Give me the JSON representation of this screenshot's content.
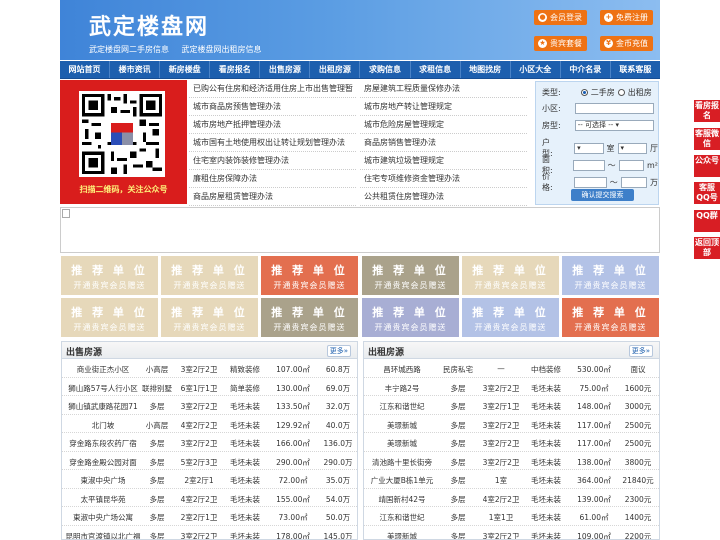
{
  "header": {
    "title": "武定楼盘网",
    "subtitles": [
      "武定楼盘网二手房信息",
      "武定楼盘网出租房信息"
    ],
    "buttons": [
      "会员登录",
      "免费注册",
      "贵宾套餐",
      "金币充值"
    ]
  },
  "nav": [
    "网站首页",
    "楼市资讯",
    "新房楼盘",
    "看房报名",
    "出售房源",
    "出租房源",
    "求购信息",
    "求租信息",
    "地图找房",
    "小区大全",
    "中介名录",
    "联系客服"
  ],
  "qr": {
    "caption": "扫描二维码，关注公众号"
  },
  "links_left": [
    "已购公有住房和经济适用住房上市出售管理暂",
    "城市商品房预售管理办法",
    "城市房地产抵押管理办法",
    "城市国有土地使用权出让转让规划管理办法",
    "住宅室内装饰装修管理办法",
    "廉租住房保障办法",
    "商品房屋租赁管理办法"
  ],
  "links_right": [
    "房屋建筑工程质量保修办法",
    "城市房地产转让管理规定",
    "城市危险房屋管理规定",
    "商品房销售管理办法",
    "城市建筑垃圾管理规定",
    "住宅专项维修资金管理办法",
    "公共租赁住房管理办法"
  ],
  "search": {
    "type_label": "类型:",
    "type_options": [
      "二手房",
      "出租房"
    ],
    "community_label": "小区:",
    "layout_label": "房型:",
    "layout_value": "-- 可选择 --",
    "rooms_label": "户型:",
    "room_unit": "室",
    "hall_unit": "厅",
    "area_label": "面积:",
    "area_sep": "～",
    "area_unit": "m²",
    "price_label": "价格:",
    "price_sep": "～",
    "price_unit": "万",
    "submit": "确认提交搜索"
  },
  "ads": {
    "title": "推 荐 单 位",
    "subtitle": "开通贵宾会员赠送",
    "colors": [
      "#e6d8ba",
      "#e6d8ba",
      "#e36f4f",
      "#aaa28b",
      "#e6d8ba",
      "#b3c2e6",
      "#e6d8ba",
      "#e6d8ba",
      "#aaa28b",
      "#a8aed4",
      "#b3c2e6",
      "#e36f4f"
    ]
  },
  "sale": {
    "title": "出售房源",
    "more": "更多",
    "rows": [
      [
        "商业街正杰小区",
        "小高层",
        "3室2厅2卫",
        "精致装修",
        "107.00㎡",
        "60.8万"
      ],
      [
        "狮山路57号人行小区",
        "联排别墅",
        "6室1厅1卫",
        "简单装修",
        "130.00㎡",
        "69.0万"
      ],
      [
        "狮山镇武康路花园71",
        "多层",
        "3室2厅2卫",
        "毛坯未装",
        "133.50㎡",
        "32.0万"
      ],
      [
        "北门坡",
        "小高层",
        "4室2厅2卫",
        "毛坯未装",
        "129.92㎡",
        "40.0万"
      ],
      [
        "穿金路东段农药厂宿",
        "多层",
        "3室2厅2卫",
        "毛坯未装",
        "166.00㎡",
        "136.0万"
      ],
      [
        "穿金路金殿公园对面",
        "多层",
        "5室2厅3卫",
        "毛坯未装",
        "290.00㎡",
        "290.0万"
      ],
      [
        "東淑中央广场",
        "多层",
        "2室2厅1",
        "毛坯未装",
        "72.00㎡",
        "35.0万"
      ],
      [
        "太平镇昆华苑",
        "多层",
        "4室2厅2卫",
        "毛坯未装",
        "155.00㎡",
        "54.0万"
      ],
      [
        "東淑中央广场公寓",
        "多层",
        "2室2厅1卫",
        "毛坯未装",
        "73.00㎡",
        "50.0万"
      ],
      [
        "昆明市官渡镇以北广福",
        "多层",
        "3室2厅2卫",
        "毛坯未装",
        "178.00㎡",
        "145.0万"
      ]
    ]
  },
  "rent": {
    "title": "出租房源",
    "more": "更多",
    "rows": [
      [
        "昌环城西路",
        "民房私宅",
        "—",
        "中档装修",
        "530.00㎡",
        "面议"
      ],
      [
        "丰宁路2号",
        "多层",
        "3室2厅2卫",
        "毛坯未装",
        "75.00㎡",
        "1600元"
      ],
      [
        "江东和谐世纪",
        "多层",
        "3室2厅1卫",
        "毛坯未装",
        "148.00㎡",
        "3000元"
      ],
      [
        "美璟新城",
        "多层",
        "3室2厅2卫",
        "毛坯未装",
        "117.00㎡",
        "2500元"
      ],
      [
        "美璟新城",
        "多层",
        "3室2厅2卫",
        "毛坯未装",
        "117.00㎡",
        "2500元"
      ],
      [
        "清池路十里长街旁",
        "多层",
        "3室2厅2卫",
        "毛坯未装",
        "138.00㎡",
        "3800元"
      ],
      [
        "广业大厦B栋1单元",
        "多层",
        "1室",
        "毛坯未装",
        "364.00㎡",
        "21840元"
      ],
      [
        "靖国新村42号",
        "多层",
        "4室2厅2卫",
        "毛坯未装",
        "139.00㎡",
        "2300元"
      ],
      [
        "江东和谐世纪",
        "多层",
        "1室1卫",
        "毛坯未装",
        "61.00㎡",
        "1400元"
      ],
      [
        "美璟新城",
        "多层",
        "3室2厅2卫",
        "毛坯未装",
        "109.00㎡",
        "2200元"
      ]
    ]
  },
  "float": [
    "看房报名",
    "客服微信",
    "公众号",
    "客服QQ号",
    "QQ群",
    "返回顶部"
  ]
}
